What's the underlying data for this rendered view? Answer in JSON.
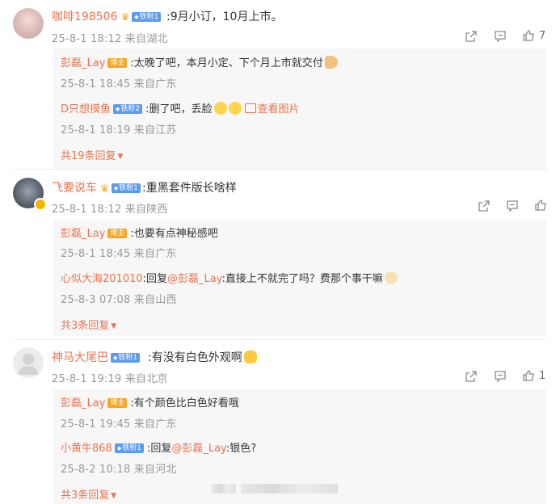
{
  "comments": [
    {
      "user": "咖啡198506",
      "badge": "铁粉1",
      "text": ":9月小订，10月上市。",
      "meta": "25-8-1 18:12 来自湖北",
      "likes": "7",
      "replies": [
        {
          "user": "彭磊_Lay",
          "badge": "博主",
          "text": ":太晚了吧，本月小定、下个月上市就交付",
          "meta": "25-8-1 18:45 来自广东"
        },
        {
          "user": "D只想摸鱼",
          "badge": "铁粉2",
          "text": ":删了吧，丢脸",
          "link": "查看图片",
          "meta": "25-8-1 18:19 来自江苏"
        }
      ],
      "more": "共19条回复"
    },
    {
      "user": "飞要说车",
      "badge": "铁粉1",
      "text": ":重黑套件版长啥样",
      "meta": "25-8-1 18:12 来自陕西",
      "likes": "",
      "replies": [
        {
          "user": "彭磊_Lay",
          "badge": "博主",
          "text": ":也要有点神秘感吧",
          "meta": "25-8-1 18:45 来自广东"
        },
        {
          "user": "心似大海201010",
          "text_prefix": ":回复",
          "mention": "@彭磊_Lay",
          "text": ":直接上不就完了吗？费那个事干嘛",
          "meta": "25-8-3 07:08 来自山西"
        }
      ],
      "more": "共3条回复"
    },
    {
      "user": "神马大尾巴",
      "badge": "铁粉1",
      "text": ":有没有白色外观啊",
      "meta": "25-8-1 19:19 来自北京",
      "likes": "1",
      "replies": [
        {
          "user": "彭磊_Lay",
          "badge": "博主",
          "text": ":有个颜色比白色好看哦",
          "meta": "25-8-1 19:45 来自广东"
        },
        {
          "user": "小黄牛868",
          "badge": "铁粉1",
          "text_prefix": ":回复",
          "mention": "@彭磊_Lay",
          "text": ":银色?",
          "meta": "25-8-2 10:18 来自河北"
        }
      ],
      "more": "共3条回复"
    }
  ],
  "colors": {
    "accent": "#eb7350",
    "meta": "#999999",
    "fan_badge": "#5b9bf0",
    "blogger_badge": "#f5a623"
  }
}
